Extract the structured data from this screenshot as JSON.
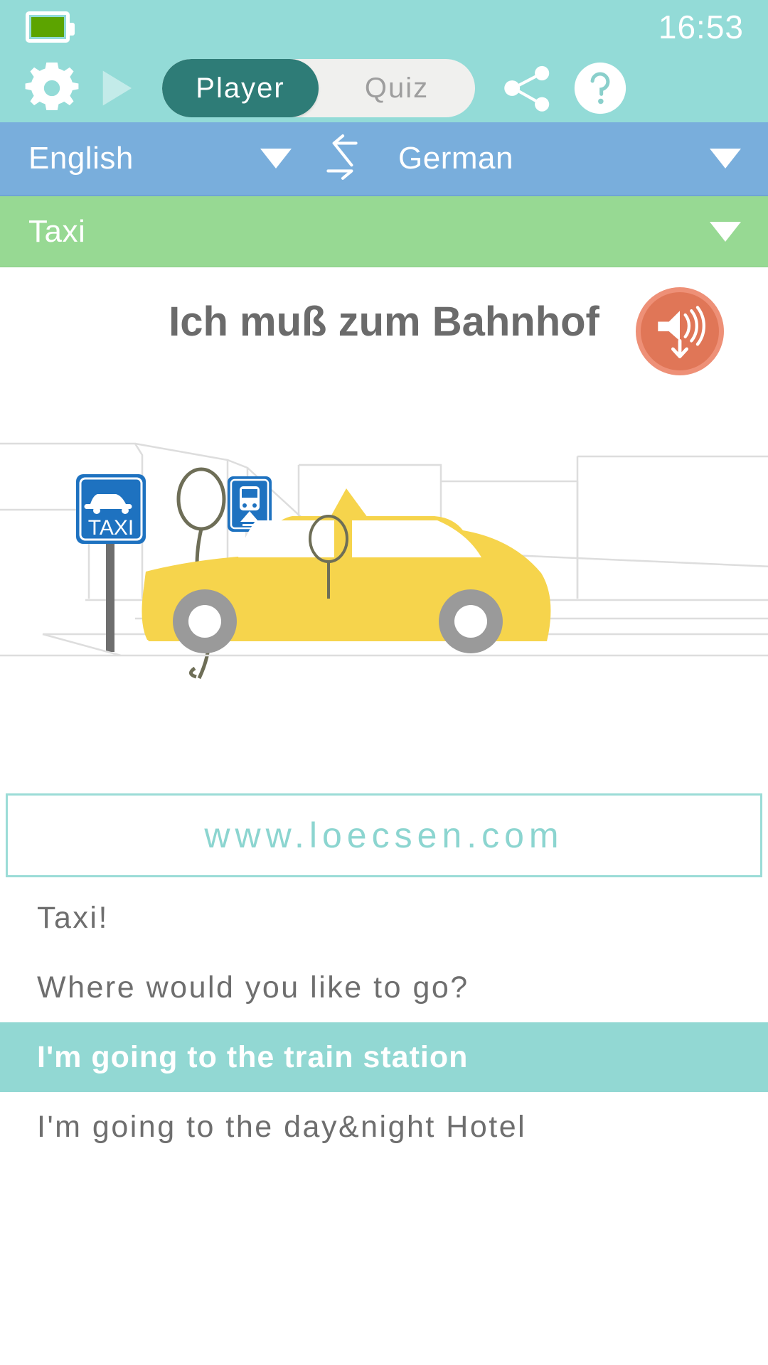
{
  "status_bar": {
    "battery_icon": "battery-full-icon",
    "time": "16:53"
  },
  "toolbar": {
    "settings_icon": "gear-icon",
    "play_icon": "play-icon",
    "share_icon": "share-icon",
    "help_icon": "help-icon",
    "mode_tabs": [
      {
        "label": "Player",
        "active": true
      },
      {
        "label": "Quiz",
        "active": false
      }
    ]
  },
  "language_bar": {
    "source_language": "English",
    "target_language": "German",
    "swap_icon": "swap-arrows-icon",
    "source_caret_icon": "chevron-down-icon",
    "target_caret_icon": "chevron-down-icon"
  },
  "category_bar": {
    "category": "Taxi",
    "caret_icon": "chevron-down-icon"
  },
  "phrase_header": {
    "translated_phrase": "Ich muß zum Bahnhof",
    "speaker_icon": "speaker-download-icon"
  },
  "illustration": {
    "name": "taxi-street-scene",
    "taxi_sign_label": "TAXI",
    "train_sign_icon": "train-icon"
  },
  "banner": {
    "website": "www.loecsen.com"
  },
  "phrase_list": [
    {
      "text": "Taxi!",
      "selected": false
    },
    {
      "text": "Where would you like to go?",
      "selected": false
    },
    {
      "text": "I'm going to the train station",
      "selected": true
    },
    {
      "text": "I'm going to the day&night Hotel",
      "selected": false
    }
  ],
  "colors": {
    "header_teal": "#93DBD7",
    "active_tab_teal": "#2E7C77",
    "language_blue": "#79AEDC",
    "category_green": "#97D993",
    "speaker_orange": "#E07657",
    "banner_teal": "#8CD5D0",
    "selected_row_teal": "#92D8D3",
    "battery_green": "#5CA400",
    "taxi_yellow": "#F6D44C",
    "sign_blue": "#1E72C0"
  }
}
